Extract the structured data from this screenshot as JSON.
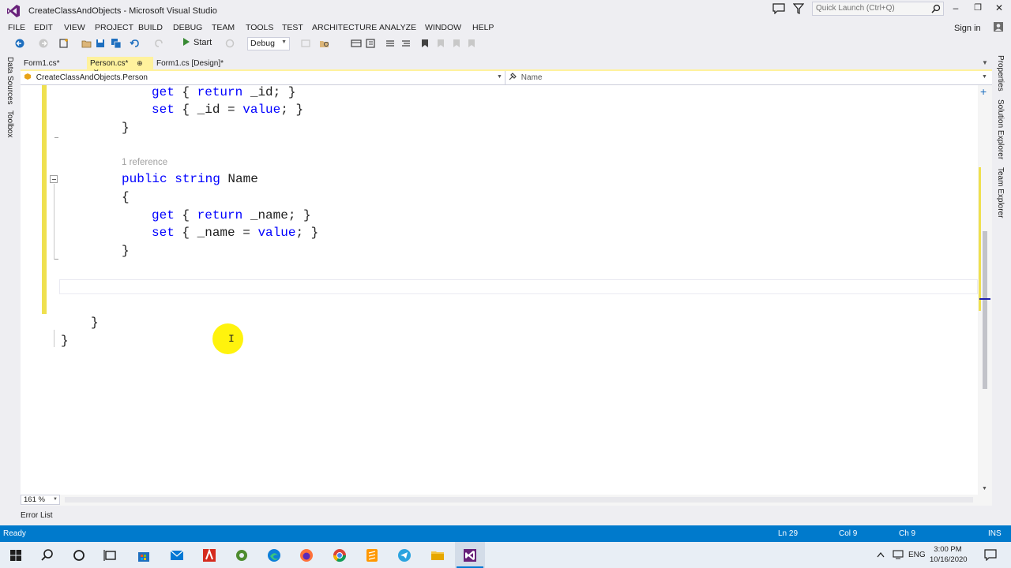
{
  "window": {
    "title": "CreateClassAndObjects - Microsoft Visual Studio",
    "quick_launch_placeholder": "Quick Launch (Ctrl+Q)",
    "sign_in": "Sign in",
    "minimize": "–",
    "maximize": "❐",
    "close": "✕"
  },
  "menu": [
    "FILE",
    "EDIT",
    "VIEW",
    "PROJECT",
    "BUILD",
    "DEBUG",
    "TEAM",
    "TOOLS",
    "TEST",
    "ARCHITECTURE",
    "ANALYZE",
    "WINDOW",
    "HELP"
  ],
  "toolbar": {
    "start_label": "Start",
    "configuration": "Debug"
  },
  "left_tabs": [
    "Data Sources",
    "Toolbox"
  ],
  "right_tabs": [
    "Properties",
    "Solution Explorer",
    "Team Explorer"
  ],
  "document_tabs": [
    {
      "label": "Form1.cs*",
      "active": false
    },
    {
      "label": "Person.cs*",
      "active": true,
      "pin": "⊕",
      "close": "✕"
    },
    {
      "label": "Form1.cs [Design]*",
      "active": false
    }
  ],
  "navigation": {
    "class_scope": "CreateClassAndObjects.Person",
    "member_scope": "Name"
  },
  "code": {
    "line1_get": "get",
    "line1_rest": "{ ",
    "line1_return": "return",
    "line1_tail": " _id; }",
    "line2_set": "set",
    "line2_rest": " { _id = ",
    "line2_value": "value",
    "line2_tail": "; }",
    "line3": "}",
    "codelens": "1 reference",
    "line5_public": "public",
    "line5_string": "string",
    "line5_name": " Name",
    "line6": "{",
    "line7_get": "get",
    "line7_rest": " { ",
    "line7_return": "return",
    "line7_tail": " _name; }",
    "line8_set": "set",
    "line8_rest": " { _name = ",
    "line8_value": "value",
    "line8_tail": "; }",
    "line9": "}",
    "line11": "}",
    "line12": "}"
  },
  "editor": {
    "zoom": "161 %"
  },
  "bottom_panel": {
    "error_list": "Error List"
  },
  "status": {
    "ready": "Ready",
    "ln": "Ln 29",
    "col": "Col 9",
    "ch": "Ch 9",
    "mode": "INS"
  },
  "taskbar": {
    "lang": "ENG",
    "time": "3:00 PM",
    "date": "10/16/2020"
  },
  "colors": {
    "accent": "#007ACC",
    "keyword": "#0000FF",
    "change_marker": "#EFE04F",
    "active_tab": "#FFF29D"
  }
}
